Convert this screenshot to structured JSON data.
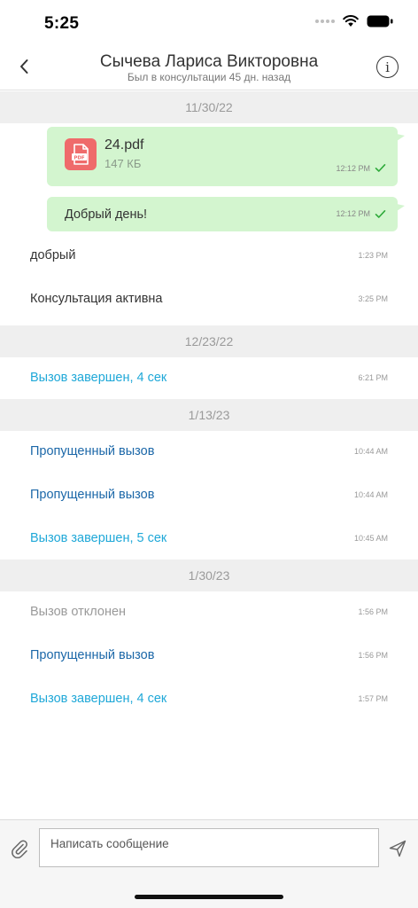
{
  "status_bar": {
    "time": "5:25",
    "icons": [
      "signal-dots-icon",
      "wifi-icon",
      "battery-icon"
    ]
  },
  "header": {
    "title": "Сычева Лариса Викторовна",
    "subtitle": "Был в консультации 45 дн. назад",
    "back_icon": "chevron-left-icon",
    "info_icon": "info-icon",
    "info_glyph": "i"
  },
  "colors": {
    "outgoing_bubble": "#d3f5cf",
    "date_separator": "#efefef",
    "call_completed": "#1fa8d8",
    "call_missed": "#1b67a8",
    "call_declined": "#9a9a9a",
    "pdf_icon": "#ef6b6b",
    "check": "#2eaa3a"
  },
  "chat": {
    "groups": [
      {
        "date": "11/30/22",
        "file_message": {
          "icon": "pdf-file-icon",
          "icon_label": "PDF",
          "name": "24.pdf",
          "size": "147 КБ",
          "time": "12:12 PM",
          "status_icon": "check-icon"
        },
        "outgoing_message": {
          "text": "Добрый день!",
          "time": "12:12 PM",
          "status_icon": "check-icon"
        },
        "messages": [
          {
            "text": "добрый",
            "time": "1:23 PM"
          },
          {
            "text": "Консультация активна",
            "time": "3:25 PM"
          }
        ]
      },
      {
        "date": "12/23/22",
        "messages": [
          {
            "text": "Вызов завершен, 4 сек",
            "time": "6:21 PM"
          }
        ]
      },
      {
        "date": "1/13/23",
        "messages": [
          {
            "text": "Пропущенный вызов",
            "time": "10:44 AM"
          },
          {
            "text": "Пропущенный вызов",
            "time": "10:44 AM"
          },
          {
            "text": "Вызов завершен, 5 сек",
            "time": "10:45 AM"
          }
        ]
      },
      {
        "date": "1/30/23",
        "messages": [
          {
            "text": "Вызов отклонен",
            "time": "1:56 PM"
          },
          {
            "text": "Пропущенный вызов",
            "time": "1:56 PM"
          },
          {
            "text": "Вызов завершен, 4 сек",
            "time": "1:57 PM"
          }
        ]
      }
    ]
  },
  "input_bar": {
    "placeholder": "Написать сообщение",
    "attach_icon": "paperclip-icon",
    "send_icon": "send-icon"
  }
}
